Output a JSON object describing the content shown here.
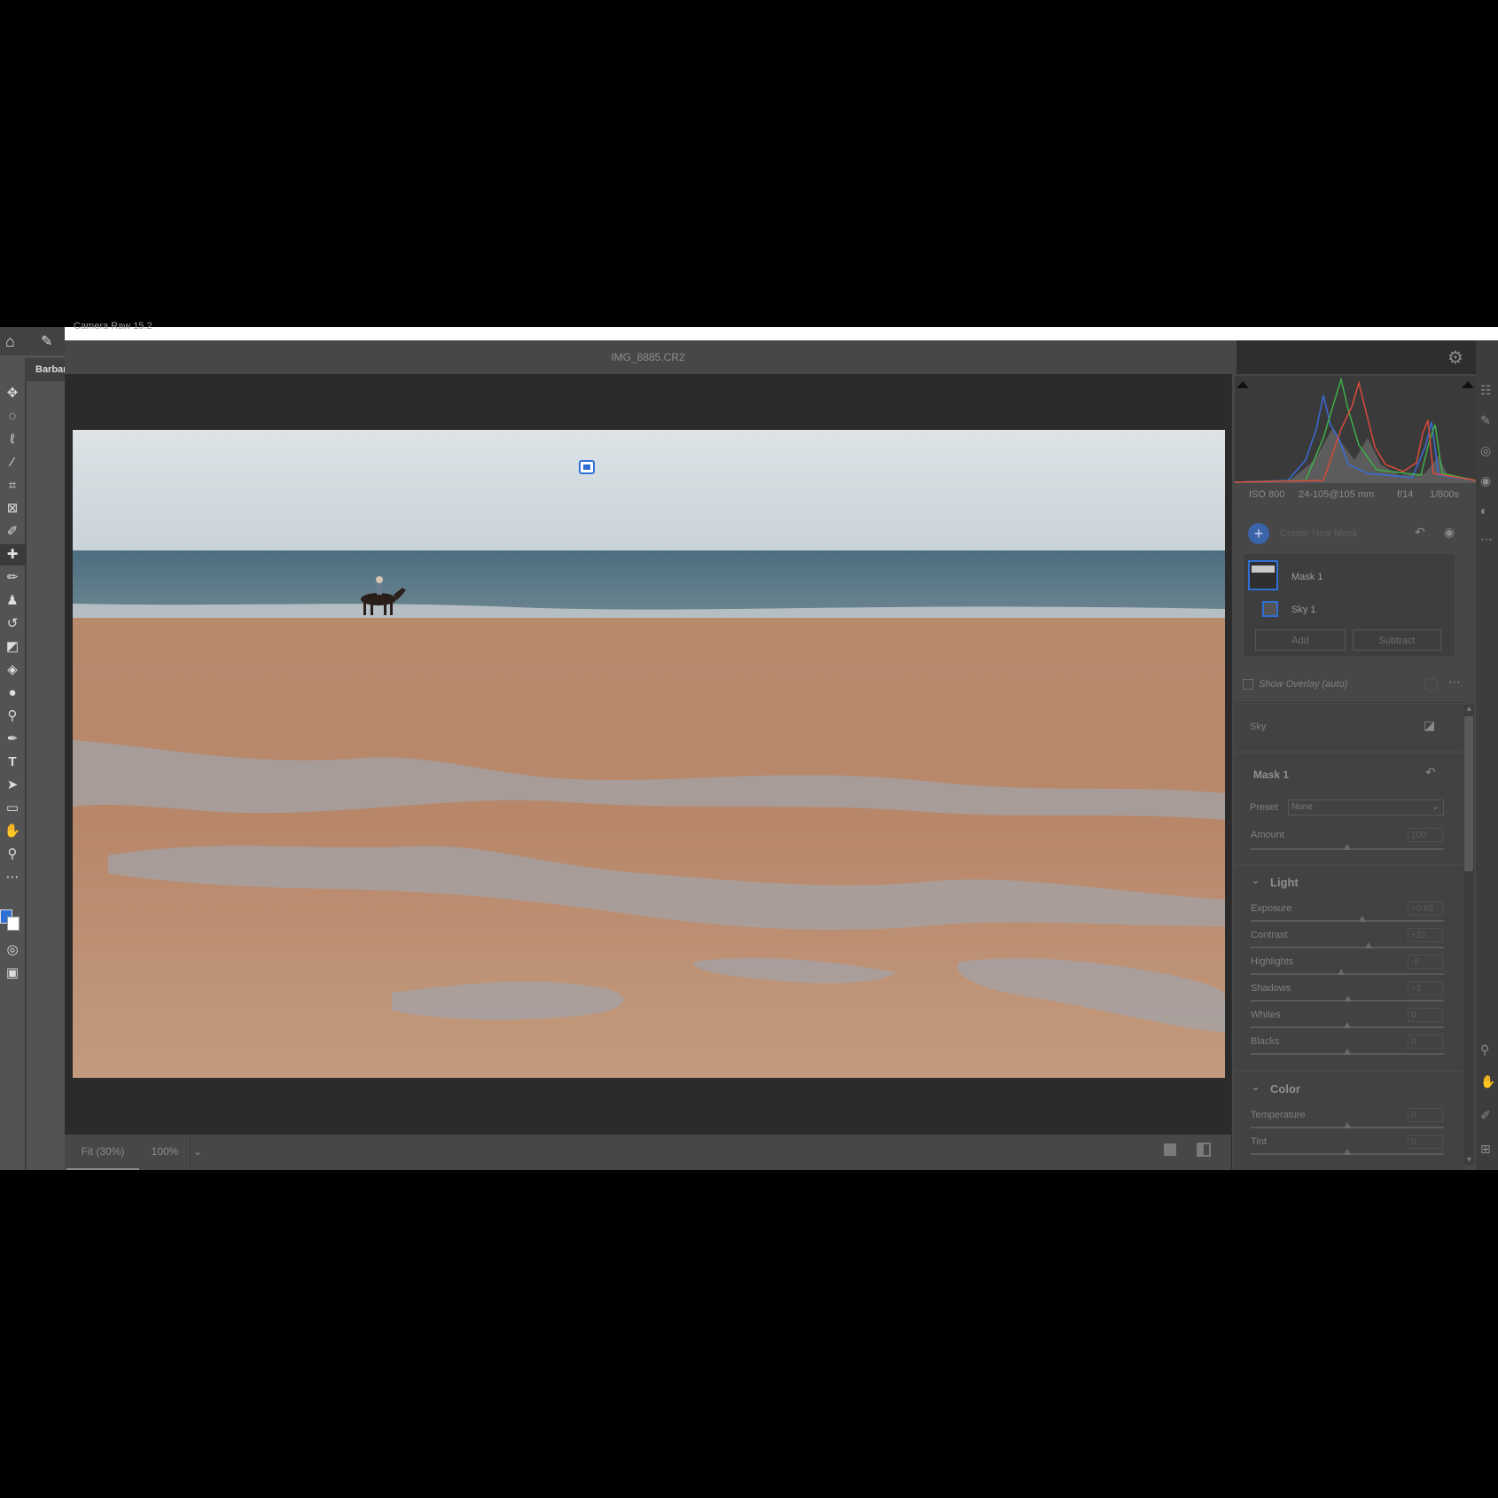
{
  "app": {
    "window_title": "Camera Raw 15.2",
    "filename": "IMG_8885.CR2",
    "ps_doc_tab": "Barbar"
  },
  "colors": {
    "accent": "#2e6fd6",
    "panel": "#474747",
    "canvas": "#2b2b2b"
  },
  "exif": {
    "iso": "ISO 800",
    "lens": "24-105@105 mm",
    "aperture": "f/14",
    "shutter": "1/800s"
  },
  "masks": {
    "create_label": "Create New Mask",
    "mask1_label": "Mask 1",
    "sky1_label": "Sky 1",
    "add_label": "Add",
    "subtract_label": "Subtract",
    "show_overlay_label": "Show Overlay (auto)"
  },
  "sky_section": {
    "label": "Sky"
  },
  "mask_props": {
    "title": "Mask 1",
    "preset_label": "Preset",
    "preset_value": "None",
    "amount_label": "Amount",
    "amount_value": "100"
  },
  "light": {
    "title": "Light",
    "sliders": [
      {
        "label": "Exposure",
        "value": "+0.65",
        "fraction": 0.58
      },
      {
        "label": "Contrast",
        "value": "+22",
        "fraction": 0.61
      },
      {
        "label": "Highlights",
        "value": "-6",
        "fraction": 0.47
      },
      {
        "label": "Shadows",
        "value": "+1",
        "fraction": 0.505
      },
      {
        "label": "Whites",
        "value": "0",
        "fraction": 0.5
      },
      {
        "label": "Blacks",
        "value": "0",
        "fraction": 0.5
      }
    ]
  },
  "color": {
    "title": "Color",
    "sliders": [
      {
        "label": "Temperature",
        "value": "0",
        "fraction": 0.5
      },
      {
        "label": "Tint",
        "value": "0",
        "fraction": 0.5
      }
    ]
  },
  "bottom": {
    "fit_label": "Fit (30%)",
    "zoom_label": "100%"
  },
  "icons": {
    "home": "home-icon",
    "settings": "gear-icon",
    "undo": "reset-icon",
    "visibility": "eye-icon",
    "more": "more-icon"
  }
}
